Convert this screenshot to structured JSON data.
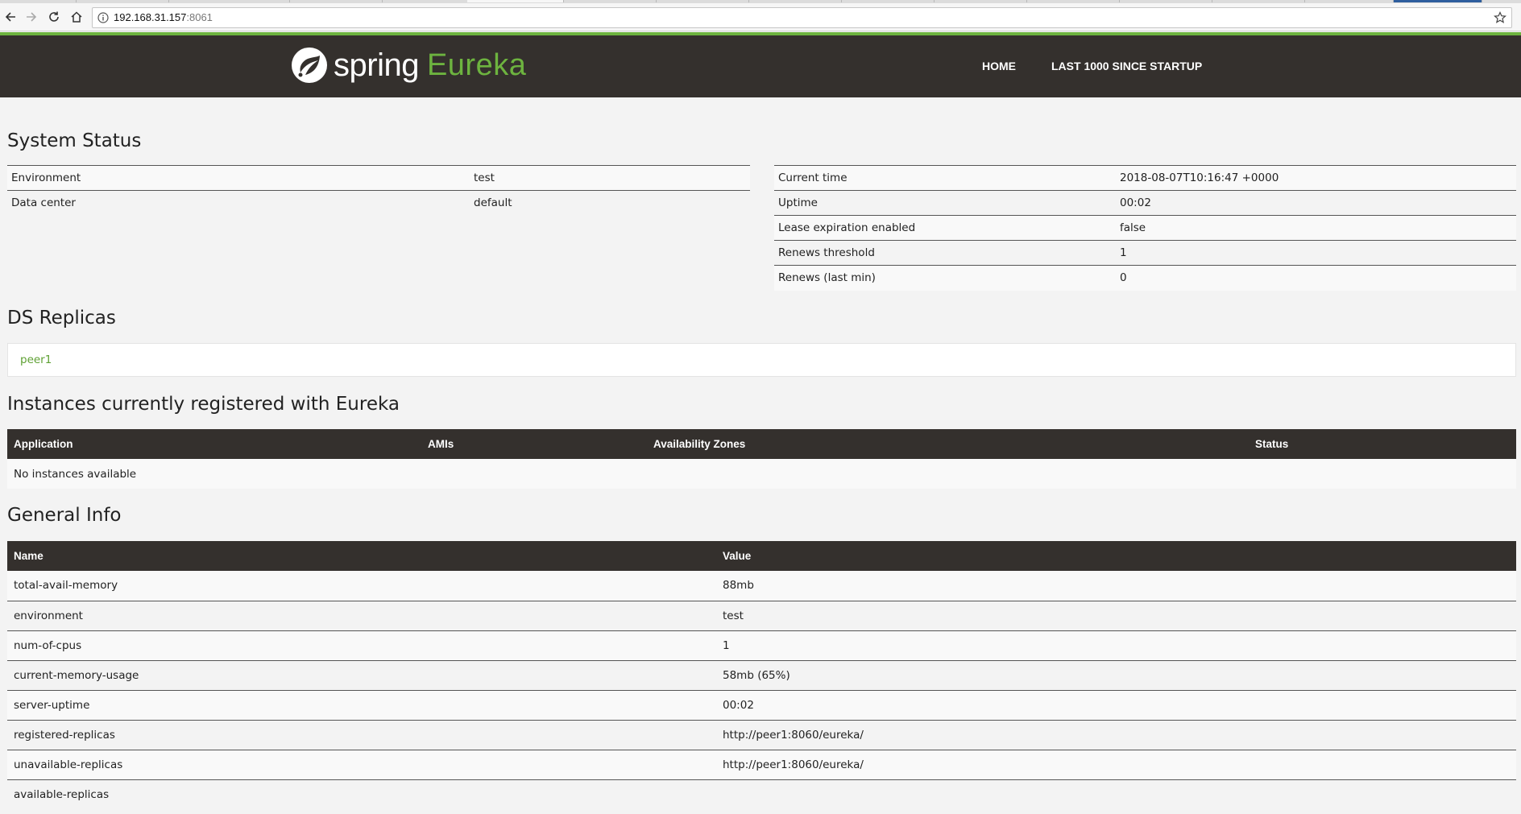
{
  "browser": {
    "url_host": "192.168.31.157",
    "url_port": ":8061"
  },
  "header": {
    "logo_spring": "spring",
    "logo_eureka": "Eureka",
    "nav": [
      "HOME",
      "LAST 1000 SINCE STARTUP"
    ]
  },
  "system_status": {
    "title": "System Status",
    "left": [
      {
        "name": "Environment",
        "value": "test"
      },
      {
        "name": "Data center",
        "value": "default"
      }
    ],
    "right": [
      {
        "name": "Current time",
        "value": "2018-08-07T10:16:47 +0000"
      },
      {
        "name": "Uptime",
        "value": "00:02"
      },
      {
        "name": "Lease expiration enabled",
        "value": "false"
      },
      {
        "name": "Renews threshold",
        "value": "1"
      },
      {
        "name": "Renews (last min)",
        "value": "0"
      }
    ]
  },
  "ds_replicas": {
    "title": "DS Replicas",
    "items": [
      "peer1"
    ]
  },
  "instances": {
    "title": "Instances currently registered with Eureka",
    "columns": [
      "Application",
      "AMIs",
      "Availability Zones",
      "Status"
    ],
    "empty_message": "No instances available"
  },
  "general_info": {
    "title": "General Info",
    "columns": [
      "Name",
      "Value"
    ],
    "rows": [
      {
        "name": "total-avail-memory",
        "value": "88mb"
      },
      {
        "name": "environment",
        "value": "test"
      },
      {
        "name": "num-of-cpus",
        "value": "1"
      },
      {
        "name": "current-memory-usage",
        "value": "58mb (65%)"
      },
      {
        "name": "server-uptime",
        "value": "00:02"
      },
      {
        "name": "registered-replicas",
        "value": "http://peer1:8060/eureka/"
      },
      {
        "name": "unavailable-replicas",
        "value": "http://peer1:8060/eureka/"
      },
      {
        "name": "available-replicas",
        "value": ""
      }
    ]
  },
  "colors": {
    "brand_green": "#6db33f",
    "header_dark": "#34302d",
    "page_bg": "#f3f3f3"
  }
}
